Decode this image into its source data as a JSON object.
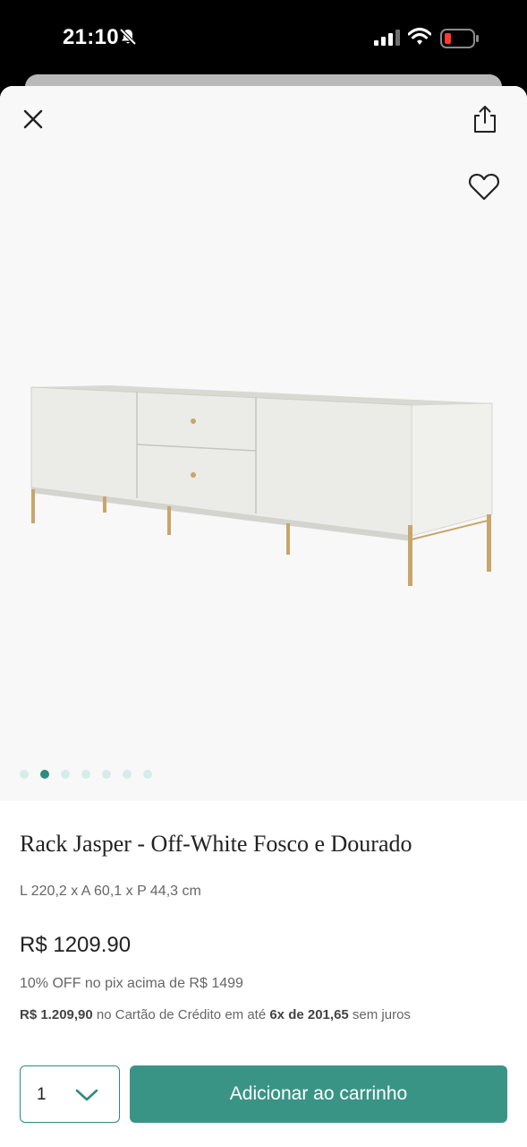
{
  "status_bar": {
    "time": "21:10",
    "icons": [
      "bell-slash-icon",
      "signal-icon",
      "wifi-icon",
      "battery-low-icon"
    ],
    "battery_color": "#ff3b30"
  },
  "header": {
    "icons": [
      "close-icon",
      "share-icon",
      "heart-icon"
    ]
  },
  "gallery": {
    "image_count": 7,
    "active_index": 1,
    "active_dot_color": "#2f8b80",
    "dot_color": "#d6ecea"
  },
  "product": {
    "title": "Rack Jasper - Off-White Fosco e Dourado",
    "dimensions": "L 220,2 x A 60,1 x P 44,3 cm",
    "price": "R$ 1209.90",
    "pix_offer": "10% OFF no pix acima de R$ 1499",
    "installments": {
      "total": "R$ 1.209,90",
      "middle": " no Cartão de Crédito em até ",
      "plan": "6x de 201,65",
      "suffix": " sem juros"
    }
  },
  "purchase": {
    "quantity": "1",
    "add_to_cart_label": "Adicionar ao carrinho",
    "accent_color": "#3a9486"
  }
}
